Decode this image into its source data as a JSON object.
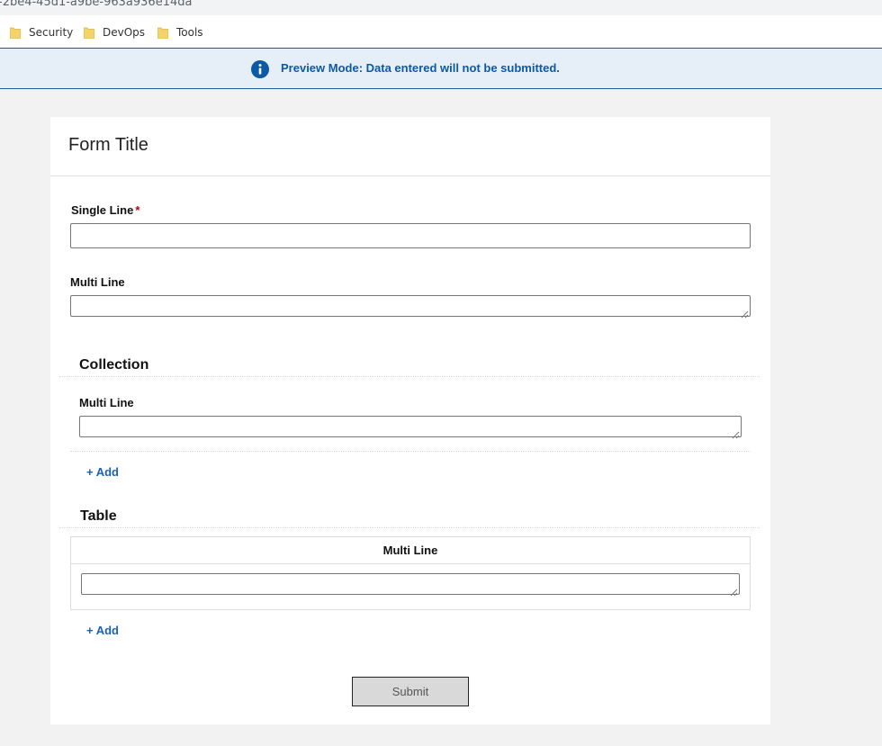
{
  "browser": {
    "url_fragment": "-2be4-45d1-a9be-963a936e14da",
    "bookmarks": [
      {
        "label": "Security",
        "icon": "folder-icon"
      },
      {
        "label": "DevOps",
        "icon": "folder-icon"
      },
      {
        "label": "Tools",
        "icon": "folder-icon"
      }
    ]
  },
  "banner": {
    "icon": "info-icon",
    "text": "Preview Mode: Data entered will not be submitted.",
    "color": "#0c5aa6"
  },
  "form": {
    "title": "Form Title",
    "fields": {
      "single_line": {
        "label": "Single Line",
        "required_marker": "*",
        "value": ""
      },
      "multi_line": {
        "label": "Multi Line",
        "value": ""
      }
    },
    "collection": {
      "title": "Collection",
      "field_label": "Multi Line",
      "value": "",
      "add_label": "+ Add"
    },
    "table": {
      "title": "Table",
      "column_header": "Multi Line",
      "value": "",
      "add_label": "+ Add"
    },
    "submit_label": "Submit"
  },
  "colors": {
    "accent": "#1a62b4",
    "required": "#c00000",
    "banner_bg": "#e6eef8"
  }
}
